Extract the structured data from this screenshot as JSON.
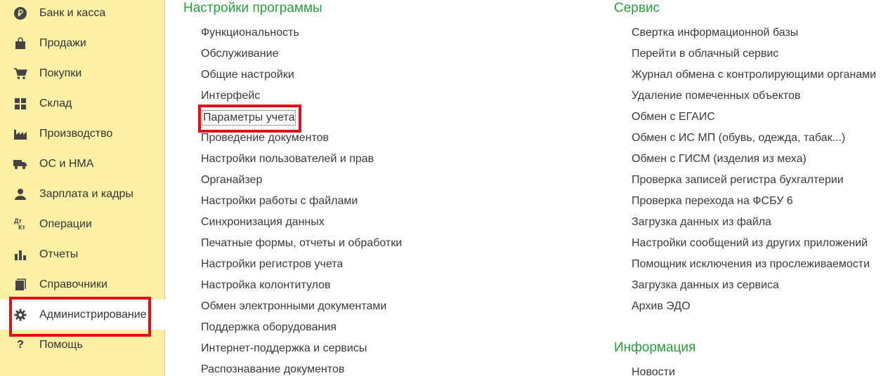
{
  "sidebar": {
    "items": [
      {
        "label": "Банк и касса",
        "icon": "ruble-icon"
      },
      {
        "label": "Продажи",
        "icon": "shopping-bag-icon"
      },
      {
        "label": "Покупки",
        "icon": "cart-icon"
      },
      {
        "label": "Склад",
        "icon": "warehouse-grid-icon"
      },
      {
        "label": "Производство",
        "icon": "factory-icon"
      },
      {
        "label": "ОС и НМА",
        "icon": "truck-icon"
      },
      {
        "label": "Зарплата и кадры",
        "icon": "person-icon"
      },
      {
        "label": "Операции",
        "icon": "dt-kt-icon",
        "glyph_top": "Дт",
        "glyph_bottom": "Кт"
      },
      {
        "label": "Отчеты",
        "icon": "bar-chart-icon"
      },
      {
        "label": "Справочники",
        "icon": "books-icon"
      },
      {
        "label": "Администрирование",
        "icon": "gear-icon",
        "active": true
      },
      {
        "label": "Помощь",
        "icon": "question-icon",
        "glyph": "?"
      }
    ]
  },
  "settings": {
    "title": "Настройки программы",
    "links": [
      "Функциональность",
      "Обслуживание",
      "Общие настройки",
      "Интерфейс",
      "Параметры учета",
      "Проведение документов",
      "Настройки пользователей и прав",
      "Органайзер",
      "Настройки работы с файлами",
      "Синхронизация данных",
      "Печатные формы, отчеты и обработки",
      "Настройки регистров учета",
      "Настройка колонтитулов",
      "Обмен электронными документами",
      "Поддержка оборудования",
      "Интернет-поддержка и сервисы",
      "Распознавание документов"
    ],
    "focused_index": 4
  },
  "service": {
    "title": "Сервис",
    "links": [
      "Свертка информационной базы",
      "Перейти в облачный сервис",
      "Журнал обмена с контролирующими органами",
      "Удаление помеченных объектов",
      "Обмен с ЕГАИС",
      "Обмен с ИС МП (обувь, одежда, табак...)",
      "Обмен с ГИСМ (изделия из меха)",
      "Проверка записей регистра бухгалтерии",
      "Проверка перехода на ФСБУ 6",
      "Загрузка данных из файла",
      "Настройки сообщений из других приложений",
      "Помощник исключения из прослеживаемости",
      "Загрузка данных из сервиса",
      "Архив ЭДО"
    ]
  },
  "info": {
    "title": "Информация",
    "links": [
      "Новости"
    ]
  },
  "colors": {
    "sidebar_bg": "#fbf0a4",
    "section_title": "#2a9d3c",
    "highlight": "#e0101a"
  }
}
